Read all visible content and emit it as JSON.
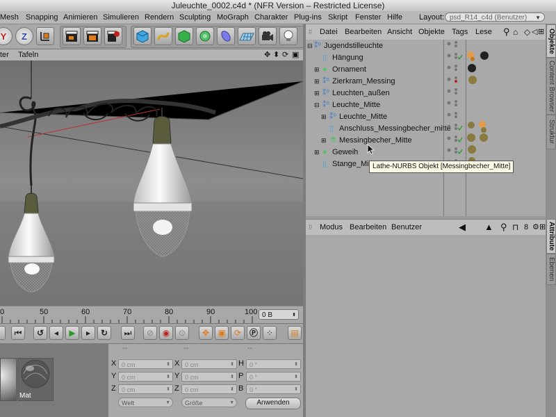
{
  "window": {
    "title": "Juleuchte_0002.c4d * (NFR Version – Restricted License)"
  },
  "menubar": {
    "items": [
      "Mesh",
      "Snapping",
      "Animieren",
      "Simulieren",
      "Rendern",
      "Sculpting",
      "MoGraph",
      "Charakter",
      "Plug-ins",
      "Skript",
      "Fenster",
      "Hilfe"
    ],
    "layout_label": "Layout:",
    "layout_value": "psd_R14_c4d (Benutzer)"
  },
  "toolbar": {
    "y_label": "Y",
    "z_label": "Z"
  },
  "viewport_menu": {
    "items": [
      "ter",
      "Tafeln"
    ]
  },
  "timeline": {
    "ticks": [
      "0",
      "50",
      "60",
      "70",
      "80",
      "90",
      "100"
    ],
    "frame_value": "0 B"
  },
  "object_manager": {
    "menu": [
      "Datei",
      "Bearbeiten",
      "Ansicht",
      "Objekte",
      "Tags",
      "Lese"
    ],
    "rows": [
      {
        "label": "Jugendstilleuchte"
      },
      {
        "label": "Hängung"
      },
      {
        "label": "Ornament"
      },
      {
        "label": "Zierkram_Messing"
      },
      {
        "label": "Leuchten_außen"
      },
      {
        "label": "Leuchte_Mitte"
      },
      {
        "label": "Leuchte_Mitte"
      },
      {
        "label": "Anschluss_Messingbecher_mitte"
      },
      {
        "label": "Messingbecher_Mitte"
      },
      {
        "label": "Geweih"
      },
      {
        "label": "Stange_Mitte"
      }
    ],
    "tooltip": "Lathe-NURBS Objekt [Messingbecher_Mitte]"
  },
  "attribute_manager": {
    "menu": [
      "Modus",
      "Bearbeiten",
      "Benutzer"
    ]
  },
  "side_tabs": {
    "objekte": "Objekte",
    "content_browser": "Content Browser",
    "struktur": "Struktur",
    "attribute": "Attribute",
    "ebenen": "Ebenen"
  },
  "material_panel": {
    "material_name": "Mat"
  },
  "coordinates": {
    "col1_labels": [
      "X",
      "Y",
      "Z"
    ],
    "col2_labels": [
      "X",
      "Y",
      "Z"
    ],
    "col3_labels": [
      "H",
      "P",
      "B"
    ],
    "pos_values": [
      "0 cm",
      "0 cm",
      "0 cm"
    ],
    "size_values": [
      "0 cm",
      "0 cm",
      "0 cm"
    ],
    "rot_values": [
      "0 °",
      "0 °",
      "0 °"
    ],
    "dash": "--",
    "mode_select": "Welt",
    "size_select": "Größe",
    "apply_label": "Anwenden"
  },
  "colors": {
    "accent_orange": "#e07b1a",
    "play_green": "#2b9a2b",
    "record_red": "#c0201a"
  }
}
